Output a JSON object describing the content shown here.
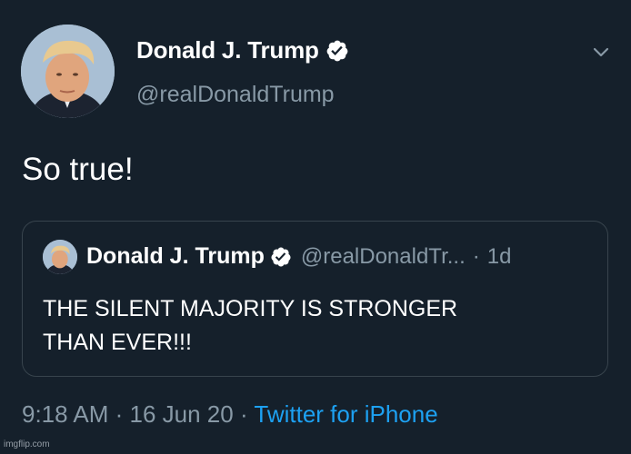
{
  "tweet": {
    "author_name": "Donald J. Trump",
    "author_handle": "@realDonaldTrump",
    "text": "So true!",
    "time": "9:18 AM",
    "separator": " · ",
    "date": "16 Jun 20",
    "source": "Twitter for iPhone"
  },
  "quoted_tweet": {
    "author_name": "Donald J. Trump",
    "author_handle": "@realDonaldTr...",
    "dot": "·",
    "age": "1d",
    "text_line1": "THE SILENT MAJORITY IS STRONGER",
    "text_line2": "THAN EVER!!!"
  },
  "icons": {
    "verified": "verified-badge-icon",
    "menu": "chevron-down-icon"
  },
  "colors": {
    "background": "#15202b",
    "secondary_text": "#8899a6",
    "link": "#1da1f2",
    "border": "#38444d"
  },
  "watermark": "imgflip.com"
}
